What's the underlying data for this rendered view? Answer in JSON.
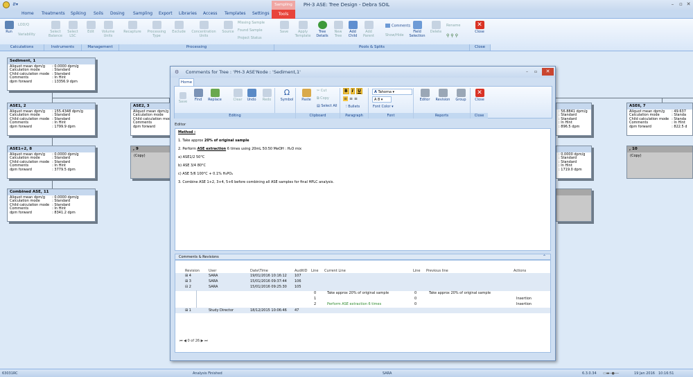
{
  "window": {
    "title": "PH-3 ASE: Tree Design - Debra SOIL",
    "context_tab": "Sampling"
  },
  "ribbon_tabs": [
    "Home",
    "Treatments",
    "Spiking",
    "Soils",
    "Dosing",
    "Sampling",
    "Export",
    "Libraries",
    "Access",
    "Templates",
    "Settings"
  ],
  "tools_tab": "Tools",
  "ribbon": {
    "run": "Run",
    "lod_q": "LOD/Q",
    "variability": "Variability",
    "select_balance": "Select Balance",
    "select_lsc": "Select LSC",
    "edit": "Edit",
    "volume_units": "Volume Units",
    "recapture": "Recapture",
    "processing_type": "Processing Type",
    "exclude": "Exclude",
    "concentration_units": "Concentration Units",
    "source": "Source",
    "missing_sample": "Missing Sample",
    "found_sample": "Found Sample",
    "project_status": "Project Status",
    "save": "Save",
    "apply_template": "Apply Template",
    "tree_details": "Tree Details",
    "new_tree": "New Tree",
    "add_child": "Add Child",
    "add_parent": "Add Parent",
    "comments": "Comments",
    "show_hide": "Show/Hide",
    "field_selection": "Field Selection",
    "delete": "Delete",
    "rename": "Rename",
    "close": "Close",
    "groups": {
      "calculations": "Calculations",
      "instruments": "Instruments",
      "management": "Management",
      "processing": "Processing",
      "pools_splits": "Pools & Splits",
      "close": "Close"
    }
  },
  "nodes": [
    {
      "title": "Sediment, 1",
      "values": [
        ": 0.0000 dpm/g",
        ": Standard",
        ": Standard",
        ": In Hint",
        ": 13356.9 dpm"
      ]
    },
    {
      "title": "ASE1, 2",
      "values": [
        ": 155.4348 dpm/g",
        ": Standard",
        ": Standard",
        ": In Hint",
        ": 1799.9 dpm"
      ]
    },
    {
      "title": "ASE1+2, 8",
      "values": [
        ": 0.0000 dpm/g",
        ": Standard",
        ": Standard",
        ": In Hint",
        ": 3779.5 dpm"
      ]
    },
    {
      "title": "Combined ASE, 11",
      "values": [
        ": 0.0000 dpm/g",
        ": Standard",
        ": Standard",
        ": In Hint",
        ": 8341.2 dpm"
      ]
    },
    {
      "title": "ASE2, 3"
    },
    {
      "title": ", 9",
      "copy": "(Copy)"
    },
    {
      "title": "ASE6, 7",
      "values": [
        ": 49.637",
        ": Standa",
        ": Standa",
        ": In Hint",
        ": 822.5 d"
      ]
    },
    {
      "title": ", 10",
      "copy": "(Copy)"
    },
    {
      "values": [
        ": 56.8841 dpm/g",
        ": Standard",
        ": Standard",
        ": In Hint",
        ": 896.5 dpm"
      ]
    },
    {
      "values": [
        ": 0.0000 dpm/g",
        ": Standard",
        ": Standard",
        ": In Hint",
        ": 1719.0 dpm"
      ]
    }
  ],
  "node_labels": [
    "Aliquot mean dpm/g",
    "Calculation mode",
    "Child calculation mode",
    "Comments",
    "dpm forward"
  ],
  "dialog": {
    "title": "Comments for Tree : 'PH-3 ASE'Node : 'Sediment,1'",
    "tab": "Home",
    "buttons": {
      "save": "Save",
      "find": "Find",
      "replace": "Replace",
      "clear": "Clear",
      "undo": "Undo",
      "redo": "Redo",
      "symbol": "Symbol",
      "paste": "Paste",
      "cut": "Cut",
      "copy": "Copy",
      "select_all": "Select All",
      "bullets": "Bullets",
      "font_name": "Tahoma",
      "font_size": "8",
      "font_color": "Font Color",
      "editor": "Editor",
      "revision": "Revision",
      "group": "Group",
      "close": "Close"
    },
    "groups": {
      "editing": "Editing",
      "clipboard": "Clipboard",
      "paragraph": "Paragraph",
      "font": "Font",
      "reports": "Reports",
      "close": "Close"
    },
    "editor_label": "Editor",
    "editor": {
      "heading": "Method :",
      "l1_pre": "1.  Take approx ",
      "l1_bold": "20% of original sample",
      "l2_pre": "2.  Perform ",
      "l2_bold": "ASE extraction",
      "l2_post": " 6 times using 20mL 50:50 MeOH : H₂O mix",
      "l3": "a) ASE1/2 50°C",
      "l4": "b) ASE 3/4 80°C",
      "l5": "c) ASE 5/6 100°C + 0.1% H₃PO₄",
      "l6": "3. Combine ASE 1+2, 3+4, 5+6 before combining all ASE samples for final HPLC analysis."
    },
    "revisions": {
      "header": "Comments & Revisions",
      "columns": [
        "Revision",
        "User",
        "Date\\Time",
        "AuditID",
        "Line",
        "Current Line",
        "Line",
        "Previous line",
        "Actions"
      ],
      "rows": [
        {
          "rev": "4",
          "user": "SARA",
          "date": "19/01/2016 10:16:12",
          "audit": "107"
        },
        {
          "rev": "3",
          "user": "SARA",
          "date": "15/01/2016 09:37:44",
          "audit": "106"
        },
        {
          "rev": "2",
          "user": "SARA",
          "date": "15/01/2016 09:25:30",
          "audit": "105"
        }
      ],
      "detail": [
        {
          "line": "0",
          "current": "Take approx 20% of original sample",
          "pline": "0",
          "previous": "Take approx 20% of original sample",
          "action": ""
        },
        {
          "line": "1",
          "current": "",
          "pline": "0",
          "previous": "",
          "action": "Insertion"
        },
        {
          "line": "2",
          "current": "Perform ASE extraction 6 times",
          "pline": "0",
          "previous": "",
          "action": "Insertion"
        }
      ],
      "last_row": {
        "rev": "1",
        "user": "Study Director",
        "date": "18/12/2015 10:06:46",
        "audit": "47"
      },
      "pager": "0 of 26"
    }
  },
  "status": {
    "left": "63031RC",
    "mid": "Analysis Finished",
    "user": "SARA",
    "version": "6.3.0.34",
    "date": "19 Jan 2016",
    "time": "10:16:51"
  }
}
